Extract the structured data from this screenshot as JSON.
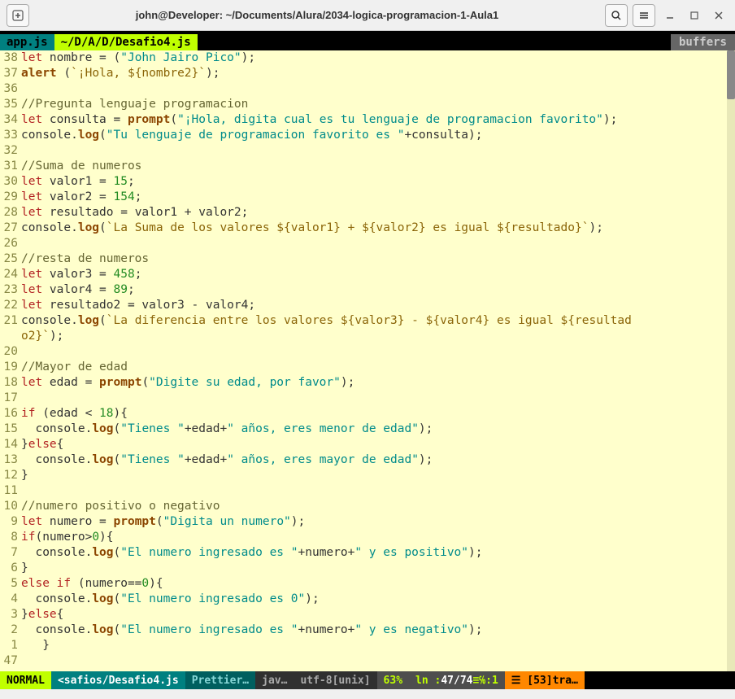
{
  "window": {
    "title": "john@Developer: ~/Documents/Alura/2034-logica-programacion-1-Aula1"
  },
  "tabs": {
    "inactive": "app.js",
    "active": "~/D/A/D/Desafio4.js",
    "buffers": "buffers"
  },
  "gutter": [
    "38",
    "37",
    "36",
    "35",
    "34",
    "33",
    "32",
    "31",
    "30",
    "29",
    "28",
    "27",
    "26",
    "25",
    "24",
    "23",
    "22",
    "21",
    "",
    "20",
    "19",
    "18",
    "17",
    "16",
    "15",
    "14",
    "13",
    "12",
    "11",
    "10",
    " 9",
    " 8",
    " 7",
    " 6",
    " 5",
    " 4",
    " 3",
    " 2",
    " 1",
    "47"
  ],
  "code": {
    "l1": {
      "kw": "let",
      "id": "nombre",
      "eq": " = (",
      "str": "\"John Jairo Pico\"",
      "end": ");"
    },
    "l2": {
      "fn": "alert",
      "open": " (",
      "str": "`¡Hola, ${nombre2}`",
      "end": ");"
    },
    "l4": {
      "cmt": "//Pregunta lenguaje programacion"
    },
    "l5": {
      "kw": "let",
      "id": "consulta",
      "eq": " = ",
      "fn": "prompt",
      "open": "(",
      "str": "\"¡Hola, digita cual es tu lenguaje de programacion favorito\"",
      "end": ");"
    },
    "l6": {
      "obj": "console",
      "dot": ".",
      "fn": "log",
      "open": "(",
      "str": "\"Tu lenguaje de programacion favorito es \"",
      "plus": "+consulta);",
      "end": ""
    },
    "l8": {
      "cmt": "//Suma de numeros"
    },
    "l9": {
      "kw": "let",
      "id": "valor1",
      "eq": " = ",
      "num": "15",
      "end": ";"
    },
    "l10": {
      "kw": "let",
      "id": "valor2",
      "eq": " = ",
      "num": "154",
      "end": ";"
    },
    "l11": {
      "kw": "let",
      "id": "resultado",
      "eq": " = valor1 + valor2;"
    },
    "l12": {
      "obj": "console",
      "dot": ".",
      "fn": "log",
      "open": "(",
      "t1": "`La Suma de los valores ",
      "i1": "${valor1}",
      "t2": " + ",
      "i2": "${valor2}",
      "t3": " es igual ",
      "i3": "${resultado}",
      "t4": "`",
      "end": ");"
    },
    "l14": {
      "cmt": "//resta de numeros"
    },
    "l15": {
      "kw": "let",
      "id": "valor3",
      "eq": " = ",
      "num": "458",
      "end": ";"
    },
    "l16": {
      "kw": "let",
      "id": "valor4",
      "eq": " = ",
      "num": "89",
      "end": ";"
    },
    "l17": {
      "kw": "let",
      "id": "resultado2",
      "eq": " = valor3 - valor4;"
    },
    "l18a": {
      "obj": "console",
      "dot": ".",
      "fn": "log",
      "open": "(",
      "t1": "`La diferencia entre los valores ",
      "i1": "${valor3}",
      "t2": " - ",
      "i2": "${valor4}",
      "t3": " es igual ",
      "i3": "${resultad"
    },
    "l18b": {
      "i3b": "o2}",
      "t4": "`",
      "end": ");"
    },
    "l21": {
      "cmt": "//Mayor de edad"
    },
    "l22": {
      "kw": "let",
      "id": "edad",
      "eq": " = ",
      "fn": "prompt",
      "open": "(",
      "str": "\"Digite su edad, por favor\"",
      "end": ");"
    },
    "l24": {
      "kw": "if",
      "open": " (edad < ",
      "num": "18",
      "close": "){"
    },
    "l25": {
      "obj": "  console",
      "dot": ".",
      "fn": "log",
      "open": "(",
      "s1": "\"Tienes \"",
      "p1": "+edad+",
      "s2": "\" años, eres menor de edad\"",
      "end": ");"
    },
    "l26": {
      "close": "}",
      "kw": "else",
      "open": "{"
    },
    "l27": {
      "obj": "  console",
      "dot": ".",
      "fn": "log",
      "open": "(",
      "s1": "\"Tienes \"",
      "p1": "+edad+",
      "s2": "\" años, eres mayor de edad\"",
      "end": ");"
    },
    "l28": {
      "close": "}"
    },
    "l30": {
      "cmt": "//numero positivo o negativo"
    },
    "l31": {
      "kw": "let",
      "id": "numero",
      "eq": " = ",
      "fn": "prompt",
      "open": "(",
      "str": "\"Digita un numero\"",
      "end": ");"
    },
    "l32": {
      "kw": "if",
      "open": "(numero>",
      "num": "0",
      "close": "){"
    },
    "l33": {
      "obj": "  console",
      "dot": ".",
      "fn": "log",
      "open": "(",
      "s1": "\"El numero ingresado es \"",
      "p1": "+numero+",
      "s2": "\" y es positivo\"",
      "end": ");"
    },
    "l34": {
      "close": "}"
    },
    "l35": {
      "kw": "else if",
      "open": " (numero==",
      "num": "0",
      "close": "){"
    },
    "l36": {
      "obj": "  console",
      "dot": ".",
      "fn": "log",
      "open": "(",
      "s1": "\"El numero ingresado es 0\"",
      "end": ");"
    },
    "l37": {
      "close": "}",
      "kw": "else",
      "open": "{"
    },
    "l38": {
      "obj": "  console",
      "dot": ".",
      "fn": "log",
      "open": "(",
      "s1": "\"El numero ingresado es \"",
      "p1": "+numero+",
      "s2": "\" y es negativo\"",
      "end": ");"
    },
    "l39": {
      "close": "   }"
    }
  },
  "status": {
    "mode": "NORMAL",
    "file": "<safios/Desafio4.js",
    "prettier": "Prettier…",
    "ft": "jav…",
    "enc": "utf-8[unix]",
    "pct": "63%",
    "pos_pre": "ln :",
    "pos_ln": "47/74",
    "pos_post": "≡℅:1",
    "trail": "☰ [53]tra…"
  }
}
